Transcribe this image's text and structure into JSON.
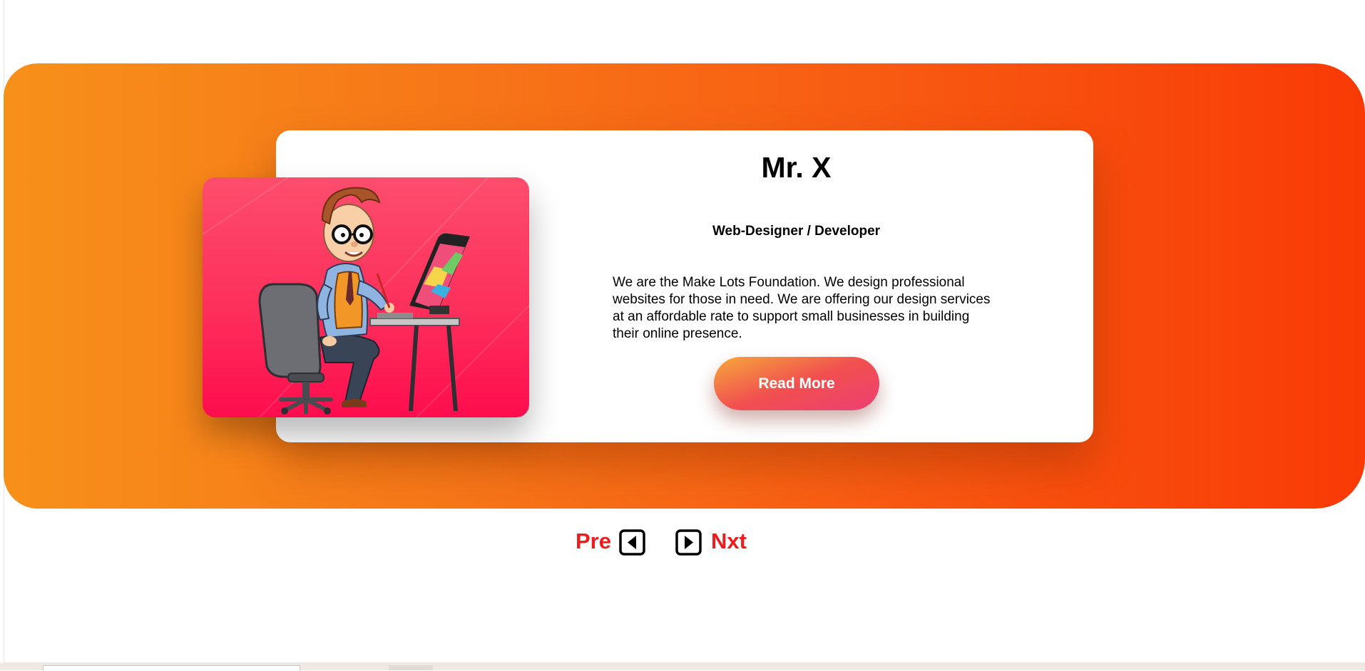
{
  "profile": {
    "name": "Mr. X",
    "role": "Web-Designer / Developer",
    "description": "We are the Make Lots Foundation. We design professional websites for those in need. We are offering our design services at an affordable rate to support small businesses in building their online presence.",
    "cta_label": "Read More",
    "illustration": "cartoon-web-designer-at-drawing-tablet"
  },
  "pagination": {
    "prev_label": "Pre",
    "next_label": "Nxt",
    "prev_icon": "caret-left-square-icon",
    "next_icon": "caret-right-square-icon"
  },
  "colors": {
    "hero_gradient": [
      "#f7901a",
      "#f93a06"
    ],
    "image_gradient": [
      "#fd4d6d",
      "#fe0d4e"
    ],
    "button_gradient": [
      "#f6a93b",
      "#ed3f74"
    ],
    "pager_text": "#ee1c1c"
  }
}
